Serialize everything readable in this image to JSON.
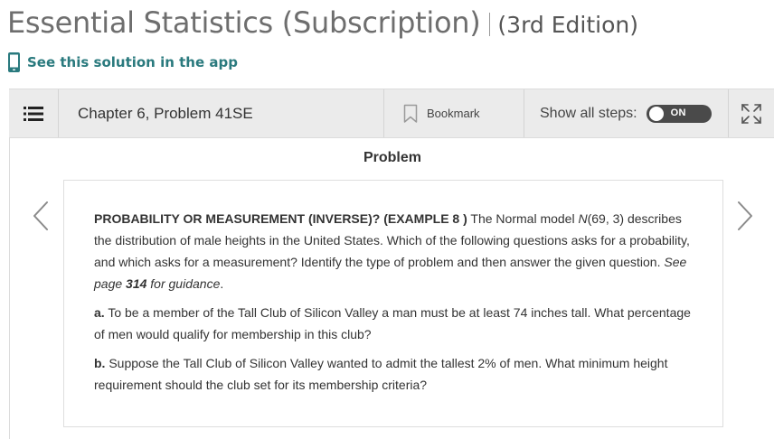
{
  "book": {
    "title": "Essential Statistics (Subscription)",
    "edition": "(3rd Edition)"
  },
  "app_link": {
    "label": "See this solution in the app",
    "icon": "phone-icon",
    "color": "#2a7a7e"
  },
  "toolbar": {
    "list_icon": "list-icon",
    "chapter": "Chapter 6, Problem 41SE",
    "bookmark_label": "Bookmark",
    "bookmark_icon": "bookmark-icon",
    "steps_label": "Show all steps:",
    "toggle_label": "ON",
    "toggle_state": true,
    "expand_icon": "expand-icon"
  },
  "problem": {
    "heading": "Problem",
    "prev_icon": "chevron-left-icon",
    "next_icon": "chevron-right-icon",
    "intro": {
      "title": "PROBABILITY OR MEASUREMENT (INVERSE)? (EXAMPLE 8 )",
      "text_1": " The Normal model ",
      "model_symbol": "N",
      "model_params": "(69, 3)",
      "text_2": " describes the distribution of male heights in the United States. Which of the following questions asks for a probability, and which asks for a measurement? Identify the type of problem and then answer the given question. ",
      "guidance_1": "See page ",
      "guidance_page": "314",
      "guidance_2": " for guidance",
      "end": "."
    },
    "part_a": {
      "label": "a.",
      "text": " To be a member of the Tall Club of Silicon Valley a man must be at least 74 inches tall. What percentage of men would qualify for membership in this club?"
    },
    "part_b": {
      "label": "b.",
      "text": " Suppose the Tall Club of Silicon Valley wanted to admit the tallest 2% of men. What minimum height requirement should the club set for its membership criteria?"
    }
  }
}
